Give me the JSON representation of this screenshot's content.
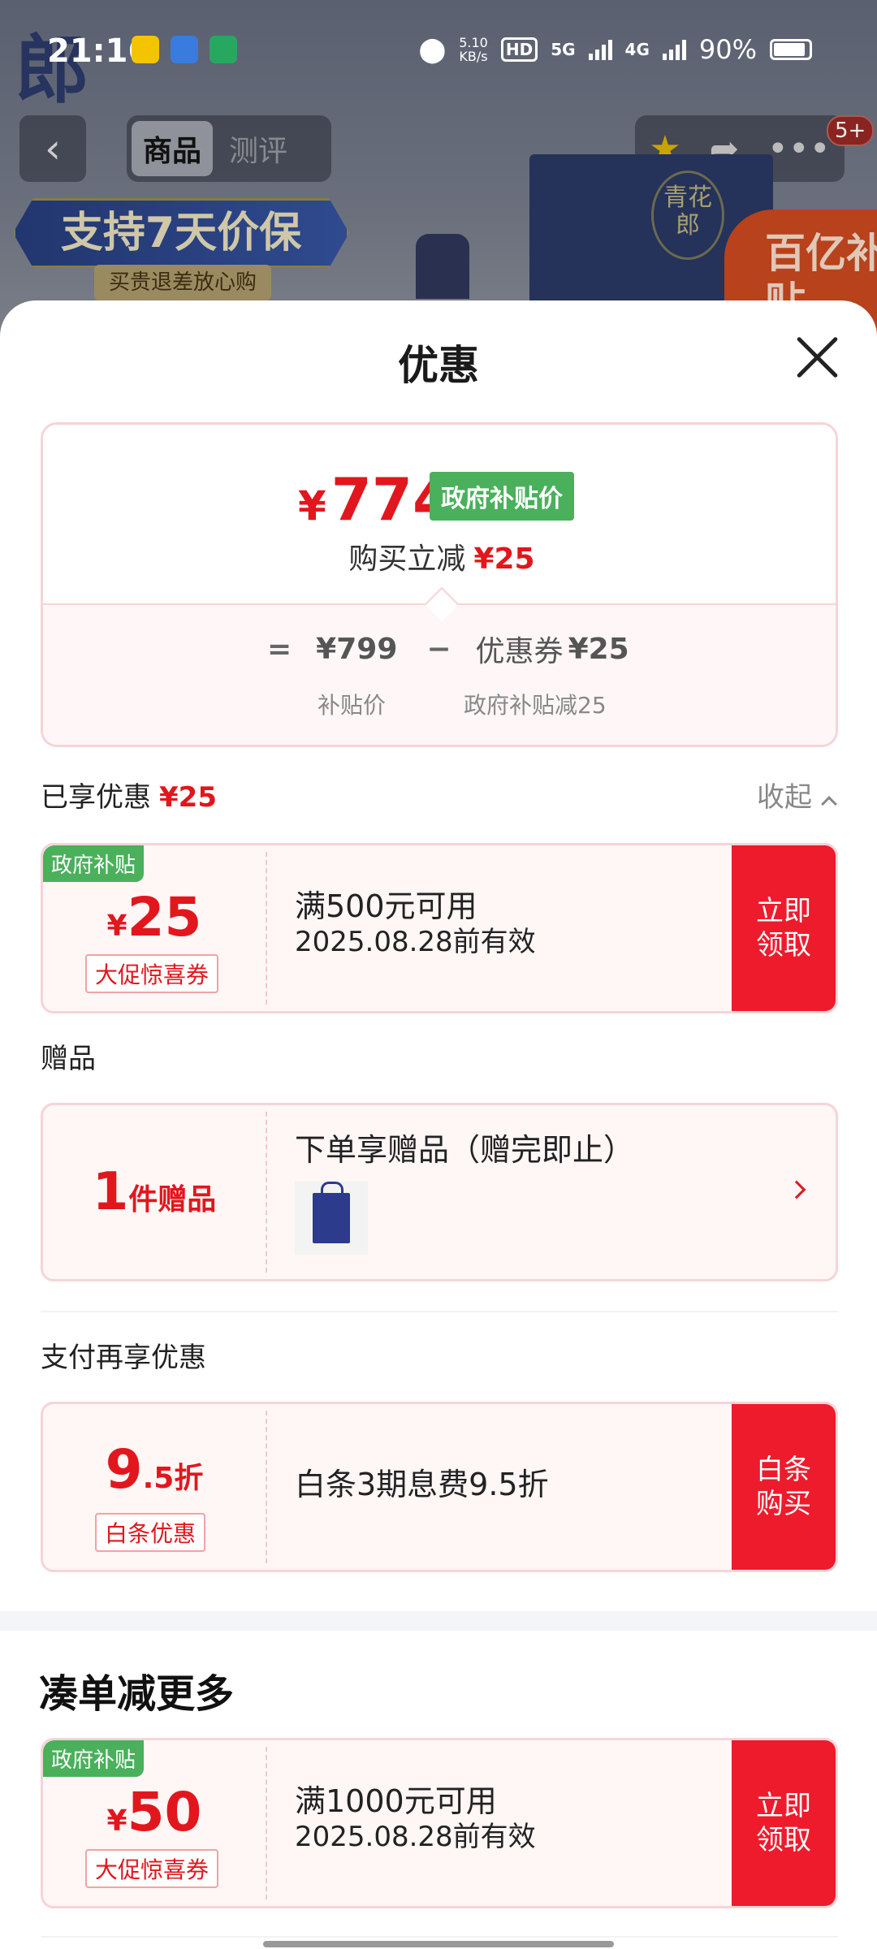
{
  "status_bar": {
    "time": "21:16",
    "net_speed_top": "5.10",
    "net_speed_bottom": "KB/s",
    "hd": "HD",
    "sim1": "5G",
    "sim2": "4G",
    "battery": "90%"
  },
  "background_page": {
    "logo_char": "郎",
    "tabs": [
      "商品",
      "测评"
    ],
    "cart_badge": "5+",
    "promo_banner": "支持7天价保",
    "promo_sub": "买贵退差放心购",
    "brand_seal": "青花郎",
    "subsidy_corner": "百亿补贴"
  },
  "sheet": {
    "title": "优惠",
    "price_card": {
      "currency": "¥",
      "final_price": "774",
      "gov_tag": "政府补贴价",
      "reduce_label": "购买立减",
      "reduce_amount": "¥25",
      "eq": "=",
      "base_price": "¥799",
      "minus": "−",
      "coupon_label": "优惠券",
      "coupon_amount": "¥25",
      "base_caption": "补贴价",
      "coupon_caption": "政府补贴减25"
    },
    "enjoyed": {
      "label": "已享优惠",
      "amount": "¥25",
      "collapse": "收起"
    },
    "coupon1": {
      "ribbon": "政府补贴",
      "currency": "¥",
      "amount": "25",
      "tag": "大促惊喜券",
      "condition": "满500元可用",
      "validity": "2025.08.28前有效",
      "action": "立即\n领取"
    },
    "gifts": {
      "label": "赠品",
      "count": "1",
      "unit": "件赠品",
      "title": "下单享赠品（赠完即止）"
    },
    "payment": {
      "label": "支付再享优惠",
      "discount_big": "9",
      "discount_small": ".5折",
      "tag": "白条优惠",
      "desc": "白条3期息费9.5折",
      "action": "白条\n购买"
    },
    "more": {
      "heading": "凑单减更多",
      "coupon": {
        "ribbon": "政府补贴",
        "currency": "¥",
        "amount": "50",
        "tag": "大促惊喜券",
        "condition": "满1000元可用",
        "validity": "2025.08.28前有效",
        "action": "立即\n领取"
      }
    }
  },
  "colors": {
    "accent_red": "#e1171d",
    "action_red": "#ee1b2c",
    "gov_green": "#4ab05b",
    "card_border": "#f6d4d8",
    "card_bg": "#fff6f6"
  }
}
